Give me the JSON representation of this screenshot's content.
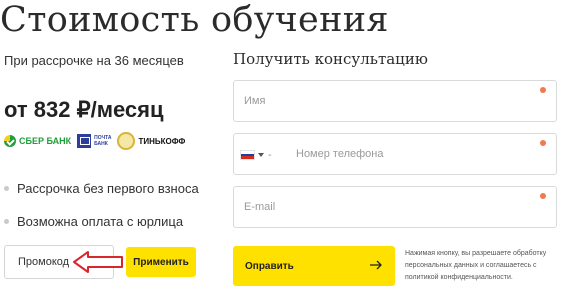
{
  "header": {
    "title": "Стоимость обучения"
  },
  "pricing": {
    "installment_text": "При рассрочке на 36 месяцев",
    "price": "от 832 ₽/месяц"
  },
  "banks": [
    {
      "icon": "sber-logo-icon",
      "label": "СБЕР БАНК",
      "color": "#1f9e3a"
    },
    {
      "icon": "pochta-bank-logo-icon",
      "label_lines": [
        "ПОЧТА",
        "БАНК"
      ],
      "color": "#2a3e9a"
    },
    {
      "icon": "tinkoff-logo-icon",
      "label": "ТИНЬКОФФ",
      "color": "#111111"
    }
  ],
  "benefits": [
    "Рассрочка без первого взноса",
    "Возможна оплата с юрлица"
  ],
  "promo": {
    "placeholder": "Промокод",
    "apply_label": "Применить",
    "annotation": "red-arrow-pointing-left"
  },
  "form": {
    "title": "Получить консультацию",
    "fields": {
      "name_placeholder": "Имя",
      "phone_placeholder": "Номер телефона",
      "email_placeholder": "E-mail"
    },
    "phone_country": "ru-flag-icon",
    "submit_label": "Оправить",
    "consent_text": "Нажимая кнопку, вы разрешаете обработку персональных данных и соглашаетесь с политикой конфиденциальности."
  },
  "colors": {
    "accent_yellow": "#ffe100",
    "required_dot": "#f07a4c",
    "annotation_red": "#d9262c",
    "sber_green": "#1f9e3a"
  }
}
